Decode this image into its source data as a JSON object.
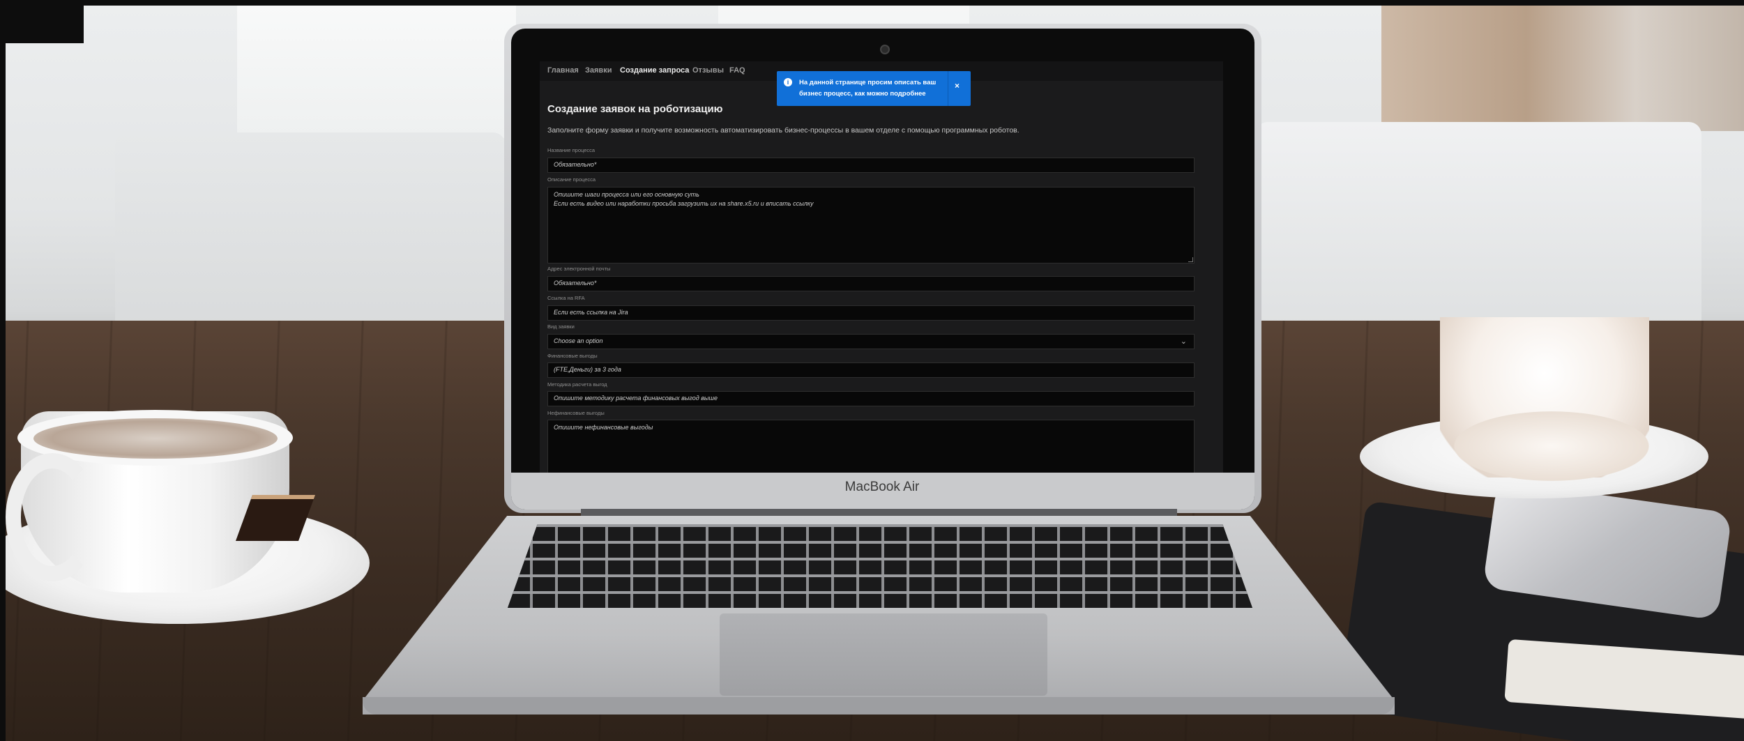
{
  "device": {
    "brand": "MacBook Air"
  },
  "nav": {
    "items": [
      "Главная",
      "Заявки",
      "Создание запроса",
      "Отзывы",
      "FAQ"
    ],
    "active": "Создание запроса"
  },
  "toast": {
    "icon": "info-icon",
    "text_line1": "На данной странице просим описать ваш",
    "text_line2": "бизнес процесс, как можно подробнее",
    "close": "×",
    "color": "#1170d8"
  },
  "form": {
    "title": "Создание заявок на роботизацию",
    "subtitle": "Заполните форму заявки и получите возможность автоматизировать бизнес-процессы в вашем отделе с помощью программных роботов.",
    "fields": [
      {
        "label": "Название процесса",
        "placeholder": "Обязательно*"
      },
      {
        "label": "Описание процесса",
        "placeholder_line1": "Опишите шаги процесса или его основную суть",
        "placeholder_line2": "Если есть видео или наработки просьба загрузить их на share.x5.ru и вписать ссылку"
      },
      {
        "label": "Адрес электронной почты",
        "placeholder": "Обязательно*"
      },
      {
        "label": "Ссылка на RFA",
        "placeholder": "Если есть ссылка на Jira"
      },
      {
        "label": "Вид заявки",
        "selected": "Choose an option"
      },
      {
        "label": "Финансовые выгоды",
        "placeholder": "(FTE,Деньги) за 3 года"
      },
      {
        "label": "Методика расчета выгод",
        "placeholder": "Опишите методику расчета финансовых выгод выше"
      },
      {
        "label": "Нефинансовые выгоды",
        "placeholder": "Опишите нефинансовые выгоды"
      }
    ]
  },
  "colors": {
    "screen_bg": "#1b1b1c",
    "input_bg": "#080808",
    "accent": "#1170d8"
  }
}
